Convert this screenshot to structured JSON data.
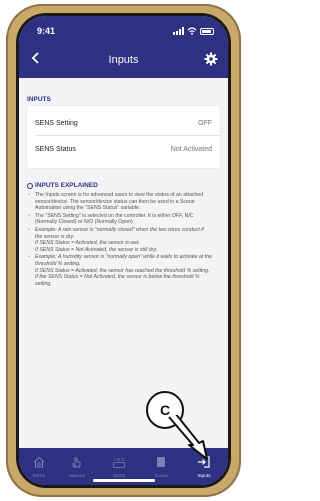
{
  "status_bar": {
    "time": "9:41"
  },
  "header": {
    "title": "Inputs",
    "back_icon": "chevron-left-icon",
    "settings_icon": "gear-icon"
  },
  "inputs": {
    "section_title": "INPUTS",
    "rows": [
      {
        "label": "SENS Setting",
        "value": "OFF"
      },
      {
        "label": "SENS Status",
        "value": "Not Activated"
      }
    ]
  },
  "explained": {
    "title": "INPUTS EXPLAINED",
    "b1": "The Inputs screen is for advanced users to view the status of an attached sensor/device. The sensor/device status can then be used in a Scene Automation using the \"SENS Status\" variable.",
    "b2": "The \"SENS Setting\" is selected on the controller. It is either OFF, N/C (Normally Closed) or N/O (Normally Open).",
    "b3": "Example: A rain sensor is \"normally closed\" when the two wires conduct if the sensor is dry.",
    "b3a": "If SENS Status = Activated, the sensor is wet.",
    "b3b": "If SENS Status = Not Activated, the sensor is still dry.",
    "b4": "Example: A humidity sensor is \"normally open\" while it waits to activate at the threshold % setting.",
    "b4a": "If SENS Status = Activated, the sensor has reached the threshold % setting.",
    "b4b": "If the SENS Status = Not Activated, the sensor is below the threshold % setting."
  },
  "tabbar": {
    "items": [
      {
        "label": "KRX8",
        "icon": "home-icon"
      },
      {
        "label": "Manual",
        "icon": "hand-icon"
      },
      {
        "label": "Starts",
        "icon": "abc-icon"
      },
      {
        "label": "Zones",
        "icon": "zones-icon"
      },
      {
        "label": "Inputs",
        "icon": "input-icon",
        "active": true
      }
    ]
  },
  "callout": {
    "letter": "C"
  },
  "colors": {
    "header": "#2e3182",
    "accent": "#2e3182",
    "background": "#f4f4f7",
    "frame": "#c9a86a"
  }
}
